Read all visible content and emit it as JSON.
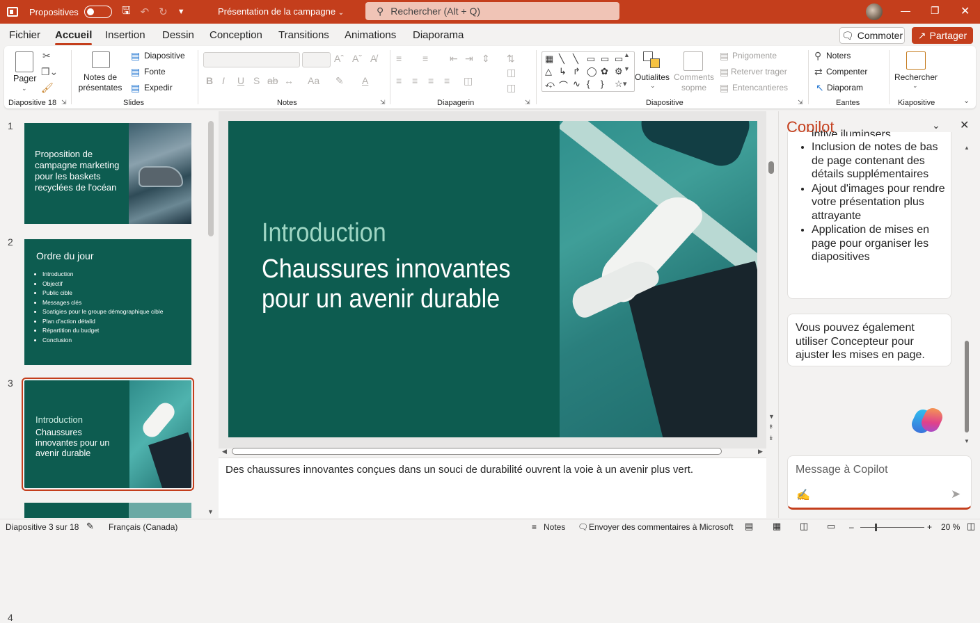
{
  "titlebar": {
    "autosave_label": "Propositives",
    "document_title": "Présentation de la campagne",
    "search_placeholder": "Rechercher (Alt + Q)"
  },
  "menu": {
    "tabs": [
      "Fichier",
      "Accueil",
      "Insertion",
      "Dessin",
      "Conception",
      "Transitions",
      "Animations",
      "Diaporama"
    ],
    "active": "Accueil",
    "comment_label": "Commoter",
    "share_label": "Partager"
  },
  "ribbon": {
    "paste": "Pager",
    "new_slide": "Notes de présentates",
    "diapositive": "Diapositive",
    "fonte": "Fonte",
    "expedir": "Expedir",
    "outils": "Outialites",
    "comments": "Comments sopme",
    "align": "Pnigomente",
    "replace": "Reterver trager",
    "entencantiers": "Entencantieres",
    "noters": "Noters",
    "compenter": "Compenter",
    "diaporam": "Diaporam",
    "rechercher": "Rechercher",
    "groups": {
      "slide_count": "Diapositive 18",
      "slides": "Slides",
      "notes": "Notes",
      "diapagerin": "Diapagerin",
      "diapositive": "Diapositive",
      "eantes": "Eantes",
      "kiapositive": "Kiapositive"
    }
  },
  "thumbnails": [
    {
      "num": "1",
      "title": "Proposition de campagne marketing pour les baskets recyclées de l'océan"
    },
    {
      "num": "2",
      "title": "Ordre du jour",
      "bullets": [
        "Introduction",
        "Objectif",
        "Public cible",
        "Messages clés",
        "Soatigies pour le groupe démographique cible",
        "Plan d'action détalid",
        "Répartition du budget",
        "Conclusion"
      ]
    },
    {
      "num": "3",
      "subtitle": "Introduction",
      "title": "Chaussures innovantes pour un avenir durable"
    },
    {
      "num": "4"
    }
  ],
  "slide": {
    "kicker": "Introduction",
    "title_line1": "Chaussures innovantes",
    "title_line2": "pour un avenir durable"
  },
  "notes_text": "Des chaussures innovantes conçues dans un souci de durabilité ouvrent la voie à un avenir plus vert.",
  "copilot": {
    "title": "Copilot",
    "cut_text": "intive iluminsers",
    "bullets": [
      "Inclusion de notes de bas de page contenant des détails supplémentaires",
      "Ajout d'images pour rendre votre présentation plus attrayante",
      "Application de mises en page pour organiser les diapositives"
    ],
    "message": "Vous pouvez également utiliser Concepteur pour ajuster les mises en page.",
    "input_placeholder": "Message à Copilot"
  },
  "status": {
    "slide_info": "Diapositive 3 sur 18",
    "language": "Français (Canada)",
    "notes": "Notes",
    "feedback": "Envoyer des commentaires à Microsoft",
    "zoom": "20 %"
  },
  "colors": {
    "accent": "#c43e1c",
    "slide_bg": "#0d5c50",
    "slide_kicker": "#9fd6c4"
  }
}
